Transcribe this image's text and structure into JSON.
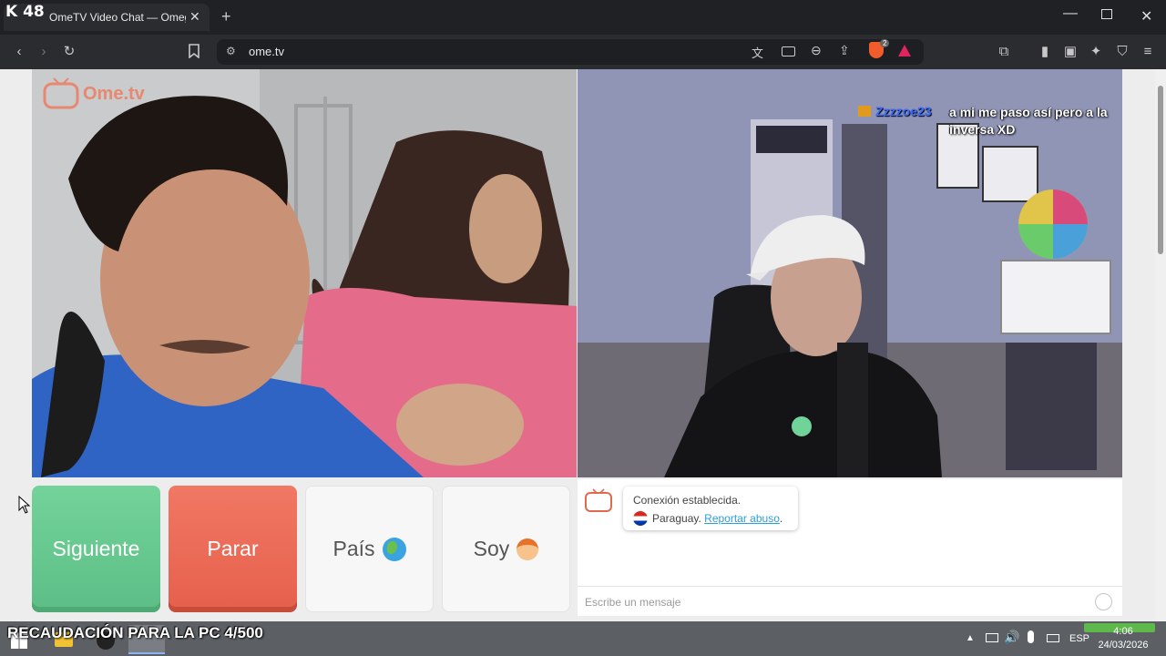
{
  "overlay": {
    "badge": "K 48"
  },
  "browser": {
    "tab_title": "OmeTV Video Chat — Omegle",
    "url": "ome.tv",
    "shield_count": "2"
  },
  "site": {
    "logo_text": "Ome.tv",
    "logo_badge": "Ome TV",
    "buttons": {
      "next": "Siguiente",
      "stop": "Parar",
      "country": "País",
      "gender": "Soy"
    },
    "chat": {
      "status": "Conexión establecida.",
      "country": "Paraguay.",
      "report": "Reportar abuso",
      "report_suffix": ".",
      "input_placeholder": "Escribe un mensaje"
    }
  },
  "stream_chat": {
    "username": "Zzzzoe23",
    "message": "a mi me paso así pero a la inversa XD",
    "username_color": "#3b6cff"
  },
  "taskbar": {
    "banner": "RECAUDACIÓN PARA LA PC 4/500",
    "language": "ESP",
    "time": "4:06",
    "date": "24/03/2026"
  },
  "colors": {
    "next": "#62c48c",
    "stop": "#e9664f",
    "link": "#2aa0d8"
  }
}
